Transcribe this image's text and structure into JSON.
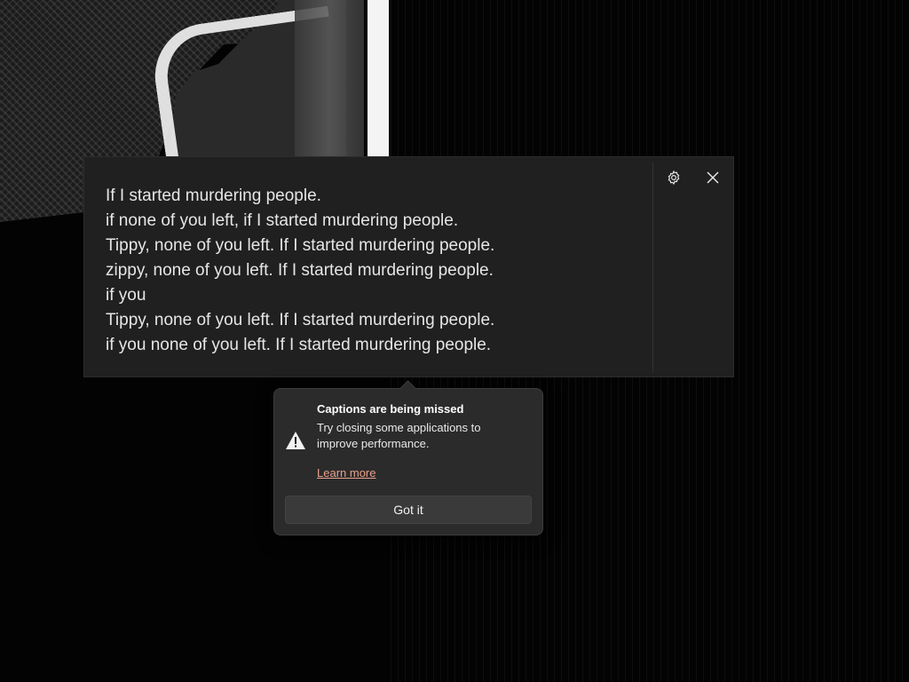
{
  "live_captions": {
    "lines": [
      "If I started murdering people.",
      "if none of you left, if I started murdering people.",
      "Tippy, none of you left. If I started murdering people.",
      "zippy, none of you left. If I started murdering people.",
      "if you",
      "Tippy, none of you left. If I started murdering people.",
      "if you none of you left. If I started murdering people."
    ],
    "settings_icon": "gear-icon",
    "close_icon": "close-icon"
  },
  "notification": {
    "title": "Captions are being missed",
    "body": "Try closing some applications to improve performance.",
    "link": "Learn more",
    "button": "Got it",
    "icon": "warning-icon"
  },
  "colors": {
    "window_bg": "#202020",
    "tip_bg": "#2b2b2b",
    "link": "#e8a08a",
    "text": "#e6e6e6"
  }
}
